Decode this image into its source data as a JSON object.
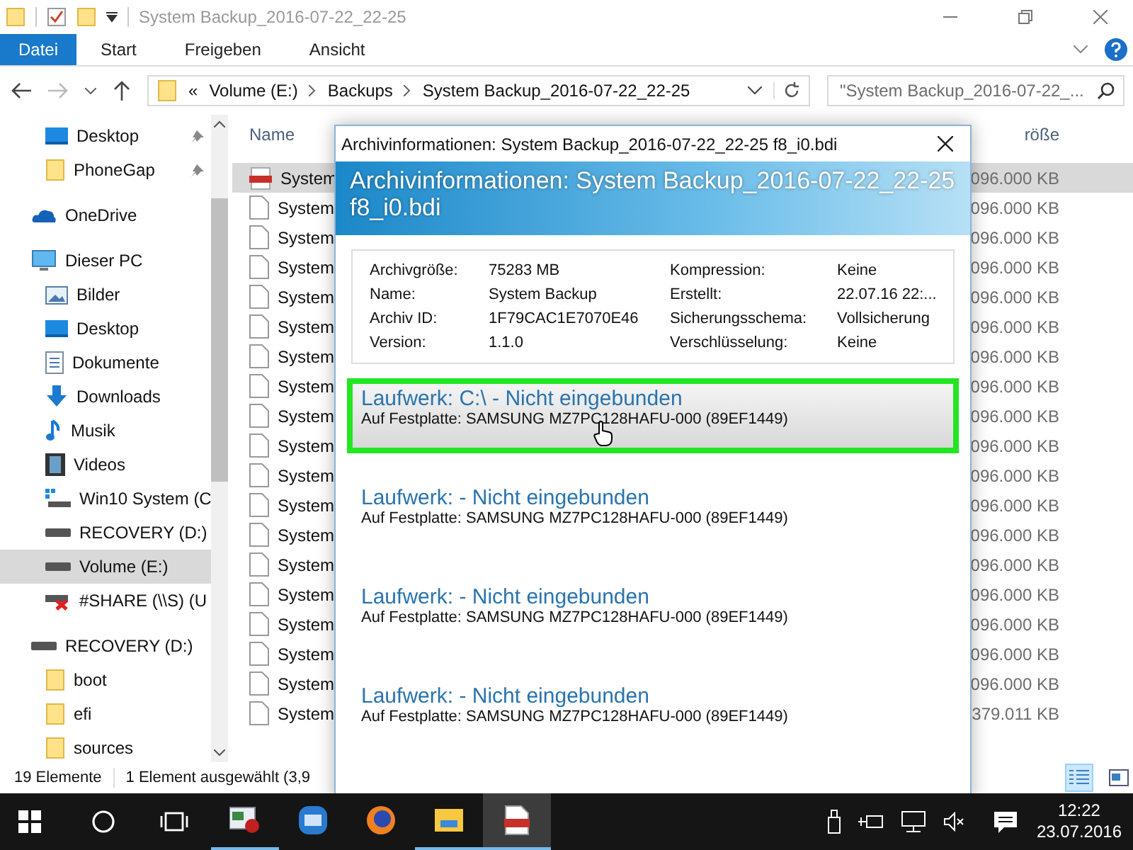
{
  "window": {
    "title": "System Backup_2016-07-22_22-25"
  },
  "ribbon_tabs": [
    {
      "label": "Datei",
      "kind": "file"
    },
    {
      "label": "Start",
      "kind": "tab"
    },
    {
      "label": "Freigeben",
      "kind": "tab"
    },
    {
      "label": "Ansicht",
      "kind": "tab"
    }
  ],
  "address": {
    "overflow": "«",
    "crumbs": [
      "Volume (E:)",
      "Backups",
      "System Backup_2016-07-22_22-25"
    ]
  },
  "search": {
    "placeholder": "\"System Backup_2016-07-22_..."
  },
  "quick_access_items": [
    {
      "label": "Desktop",
      "kind": "desktop",
      "pinned": true
    },
    {
      "label": "PhoneGap",
      "kind": "folder",
      "pinned": true
    }
  ],
  "sidebar": {
    "items": [
      {
        "label": "OneDrive",
        "kind": "cloud",
        "selected": false
      },
      {
        "label": "Dieser PC",
        "kind": "pc",
        "selected": false,
        "children": [
          {
            "label": "Bilder",
            "kind": "pictures",
            "selected": false
          },
          {
            "label": "Desktop",
            "kind": "desktop",
            "selected": false
          },
          {
            "label": "Dokumente",
            "kind": "documents",
            "selected": false
          },
          {
            "label": "Downloads",
            "kind": "downloads",
            "selected": false
          },
          {
            "label": "Musik",
            "kind": "music",
            "selected": false
          },
          {
            "label": "Videos",
            "kind": "videos",
            "selected": false
          },
          {
            "label": "Win10 System (C",
            "kind": "system-drive",
            "selected": false
          },
          {
            "label": "RECOVERY (D:)",
            "kind": "drive",
            "selected": false
          },
          {
            "label": "Volume (E:)",
            "kind": "drive",
            "selected": true
          },
          {
            "label": "#SHARE (\\\\S) (U",
            "kind": "network-drive",
            "selected": false
          }
        ]
      },
      {
        "label": "RECOVERY (D:)",
        "kind": "drive",
        "selected": false,
        "children": [
          {
            "label": "boot",
            "kind": "folder",
            "selected": false
          },
          {
            "label": "efi",
            "kind": "folder",
            "selected": false
          },
          {
            "label": "sources",
            "kind": "folder",
            "selected": false
          }
        ]
      }
    ]
  },
  "table": {
    "columns": [
      "Name",
      "röße"
    ],
    "rows": [
      {
        "name": "System",
        "size": "096.000 KB",
        "kind": "bdi",
        "selected": true
      },
      {
        "name": "System",
        "size": "096.000 KB",
        "kind": "file",
        "selected": false
      },
      {
        "name": "System",
        "size": "096.000 KB",
        "kind": "file",
        "selected": false
      },
      {
        "name": "System",
        "size": "096.000 KB",
        "kind": "file",
        "selected": false
      },
      {
        "name": "System",
        "size": "096.000 KB",
        "kind": "file",
        "selected": false
      },
      {
        "name": "System",
        "size": "096.000 KB",
        "kind": "file",
        "selected": false
      },
      {
        "name": "System",
        "size": "096.000 KB",
        "kind": "file",
        "selected": false
      },
      {
        "name": "System",
        "size": "096.000 KB",
        "kind": "file",
        "selected": false
      },
      {
        "name": "System",
        "size": "096.000 KB",
        "kind": "file",
        "selected": false
      },
      {
        "name": "System",
        "size": "096.000 KB",
        "kind": "file",
        "selected": false
      },
      {
        "name": "System",
        "size": "096.000 KB",
        "kind": "file",
        "selected": false
      },
      {
        "name": "System",
        "size": "096.000 KB",
        "kind": "file",
        "selected": false
      },
      {
        "name": "System",
        "size": "096.000 KB",
        "kind": "file",
        "selected": false
      },
      {
        "name": "System",
        "size": "096.000 KB",
        "kind": "file",
        "selected": false
      },
      {
        "name": "System",
        "size": "096.000 KB",
        "kind": "file",
        "selected": false
      },
      {
        "name": "System",
        "size": "096.000 KB",
        "kind": "file",
        "selected": false
      },
      {
        "name": "System",
        "size": "096.000 KB",
        "kind": "file",
        "selected": false
      },
      {
        "name": "System",
        "size": "096.000 KB",
        "kind": "file",
        "selected": false
      },
      {
        "name": "System",
        "size": "379.011 KB",
        "kind": "file",
        "selected": false
      }
    ]
  },
  "status_bar": {
    "count": "19 Elemente",
    "selection": "1 Element ausgewählt (3,9",
    "views": [
      {
        "kind": "details",
        "selected": true
      },
      {
        "kind": "tiles",
        "selected": false
      }
    ]
  },
  "dialog": {
    "title": "Archivinformationen: System Backup_2016-07-22_22-25  f8_i0.bdi",
    "heading": "Archivinformationen: System Backup_2016-07-22_22-25 f8_i0.bdi",
    "info_rows": [
      {
        "label": "Archivgröße:",
        "value": "75283 MB",
        "label_2": "Kompression:",
        "value_2": "Keine"
      },
      {
        "label": "Name:",
        "value": "System Backup",
        "label_2": "Erstellt:",
        "value_2": "22.07.16 22:..."
      },
      {
        "label": "Archiv ID:",
        "value": "1F79CAC1E7070E46",
        "label_2": "Sicherungsschema:",
        "value_2": "Vollsicherung"
      },
      {
        "label": "Version:",
        "value": "1.1.0",
        "label_2": "Verschlüsselung:",
        "value_2": "Keine"
      }
    ],
    "drives": [
      {
        "title": "Laufwerk: C:\\ - Nicht eingebunden",
        "disk": "Auf Festplatte: SAMSUNG MZ7PC128HAFU-000 (89EF1449)",
        "selected": true
      },
      {
        "title": "Laufwerk:  - Nicht eingebunden",
        "disk": "Auf Festplatte: SAMSUNG MZ7PC128HAFU-000 (89EF1449)",
        "selected": false
      },
      {
        "title": "Laufwerk:  - Nicht eingebunden",
        "disk": "Auf Festplatte: SAMSUNG MZ7PC128HAFU-000 (89EF1449)",
        "selected": false
      },
      {
        "title": "Laufwerk:  - Nicht eingebunden",
        "disk": "Auf Festplatte: SAMSUNG MZ7PC128HAFU-000 (89EF1449)",
        "selected": false
      }
    ]
  },
  "taskbar": {
    "apps": [
      {
        "kind": "remote",
        "running": true,
        "active": false
      },
      {
        "kind": "bm",
        "running": false,
        "active": false
      },
      {
        "kind": "browser",
        "running": false,
        "active": false
      },
      {
        "kind": "explorer",
        "running": true,
        "active": false
      },
      {
        "kind": "bdi",
        "running": true,
        "active": true
      }
    ],
    "time": "12:22",
    "date": "23.07.2016"
  }
}
